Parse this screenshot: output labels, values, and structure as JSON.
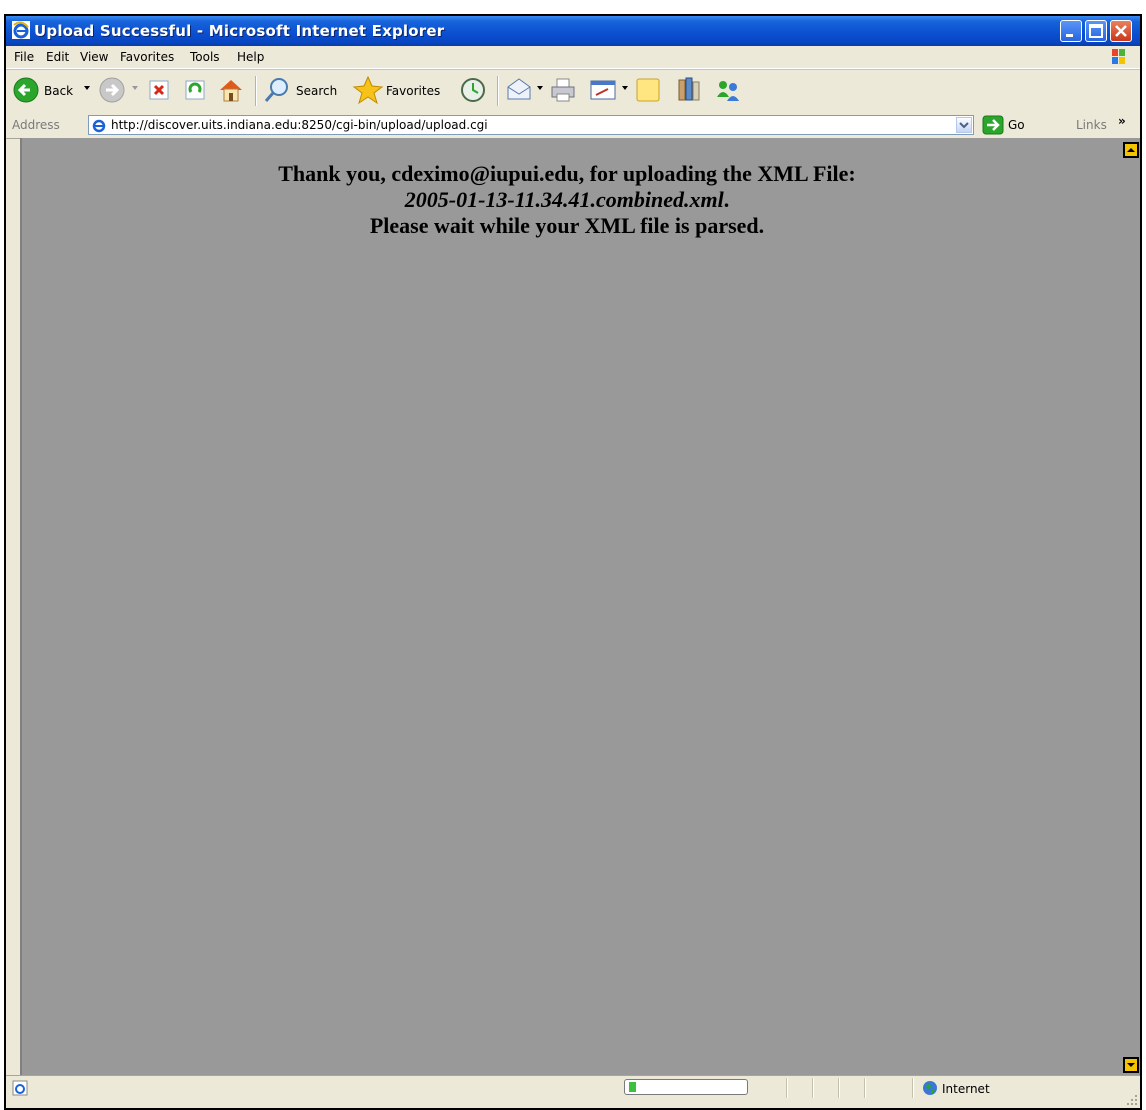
{
  "window": {
    "title": "Upload Successful - Microsoft Internet Explorer"
  },
  "menubar": {
    "items": [
      "File",
      "Edit",
      "View",
      "Favorites",
      "Tools",
      "Help"
    ]
  },
  "toolbar": {
    "back_label": "Back",
    "search_label": "Search",
    "favorites_label": "Favorites"
  },
  "address": {
    "label": "Address",
    "url": "http://discover.uits.indiana.edu:8250/cgi-bin/upload/upload.cgi",
    "go_label": "Go",
    "links_label": "Links",
    "links_chevron": "»"
  },
  "content": {
    "line1": "Thank you, cdeximo@iupui.edu, for uploading the XML File:",
    "filename": "2005-01-13-11.34.41.combined.xml",
    "filename_suffix": ".",
    "line3": "Please wait while your XML file is parsed.",
    "background_color": "#999999"
  },
  "status": {
    "zone": "Internet",
    "progress": 0.06
  },
  "colors": {
    "titlebar": "#0A4FD0",
    "chrome": "#ECE9D8",
    "scroll_button": "#F5C400"
  }
}
